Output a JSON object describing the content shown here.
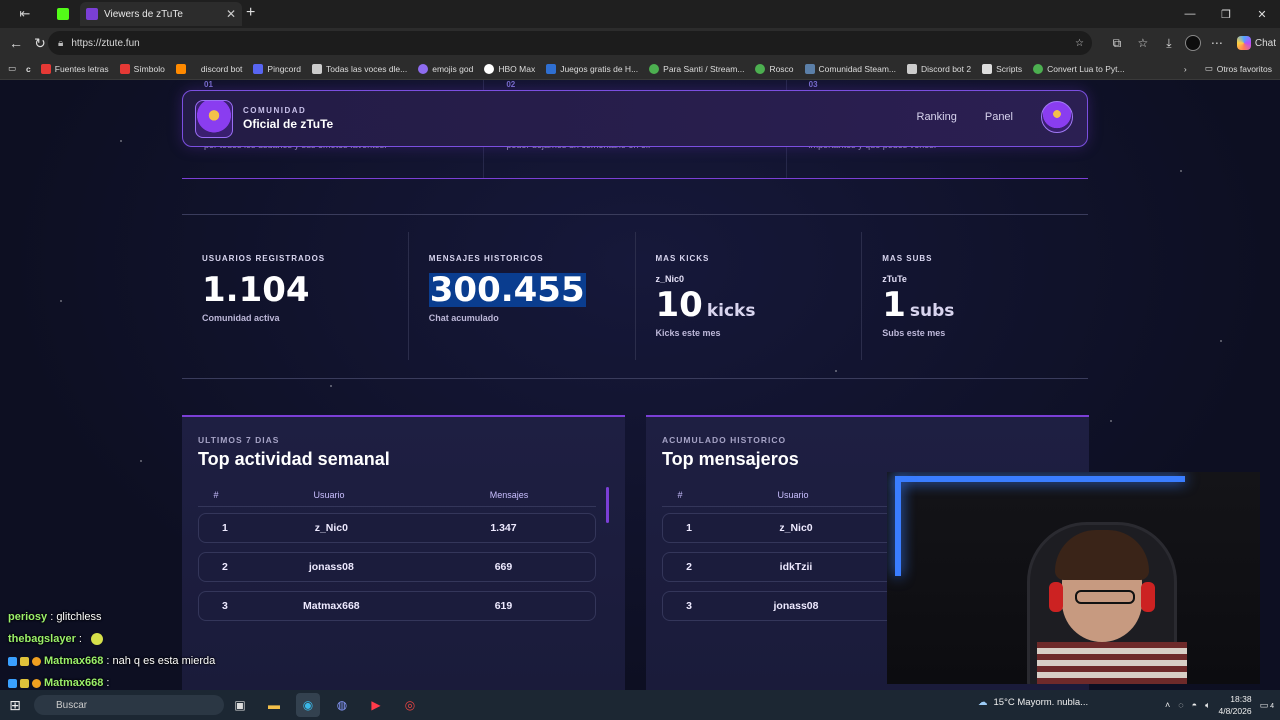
{
  "browser": {
    "tab_title": "Viewers de zTuTe",
    "url": "https://ztute.fun",
    "chat_label": "Chat",
    "bookmarks": [
      {
        "label": "Fuentes letras",
        "color": "#e53935"
      },
      {
        "label": "Símbolo",
        "color": "#e53935"
      },
      {
        "label": "",
        "color": "#ff8a00"
      },
      {
        "label": "discord bot",
        "color": "#2c2c2c"
      },
      {
        "label": "Pingcord",
        "color": "#5865f2"
      },
      {
        "label": "Todas las voces dle...",
        "color": "#cccccc"
      },
      {
        "label": "emojis god",
        "color": "#8e6cf0"
      },
      {
        "label": "HBO Max",
        "color": "#ffffff"
      },
      {
        "label": "Juegos gratis de H...",
        "color": "#2f6fd1"
      },
      {
        "label": "Para Santi / Stream...",
        "color": "#4caf50"
      },
      {
        "label": "Rosco",
        "color": "#4caf50"
      },
      {
        "label": "Comunidad Steam...",
        "color": "#1b2838"
      },
      {
        "label": "Discord bot 2",
        "color": "#cccccc"
      },
      {
        "label": "Scripts",
        "color": "#dddddd"
      },
      {
        "label": "Convert Lua to Pyt...",
        "color": "#4caf50"
      }
    ],
    "other_bookmarks": "Otros favoritos"
  },
  "topcards": [
    {
      "num": "01",
      "text": "por todos los usuarios y sus emotes favoritos."
    },
    {
      "num": "02",
      "text": "poder dejarnos un comentario en el."
    },
    {
      "num": "03",
      "text": "importantes y que podes verlos."
    }
  ],
  "hero": {
    "kicker": "COMUNIDAD",
    "title": "Oficial de zTuTe",
    "links": [
      "Ranking",
      "Panel"
    ]
  },
  "stats": [
    {
      "title": "USUARIOS REGISTRADOS",
      "value": "1.104",
      "caption": "Comunidad activa"
    },
    {
      "title": "MENSAJES HISTORICOS",
      "value": "300.455",
      "caption": "Chat acumulado"
    },
    {
      "title": "MAS KICKS",
      "sub": "z_Nic0",
      "value": "10",
      "unit": "kicks",
      "caption": "Kicks este mes"
    },
    {
      "title": "MAS SUBS",
      "sub": "zTuTe",
      "value": "1",
      "unit": "subs",
      "caption": "Subs este mes"
    }
  ],
  "weekly": {
    "kicker": "ULTIMOS 7 DIAS",
    "title": "Top actividad semanal",
    "headers": [
      "#",
      "Usuario",
      "Mensajes"
    ],
    "rows": [
      {
        "rank": "1",
        "user": "z_Nic0",
        "msgs": "1.347"
      },
      {
        "rank": "2",
        "user": "jonass08",
        "msgs": "669"
      },
      {
        "rank": "3",
        "user": "Matmax668",
        "msgs": "619"
      }
    ]
  },
  "alltime": {
    "kicker": "ACUMULADO HISTORICO",
    "title": "Top mensajeros",
    "headers": [
      "#",
      "Usuario"
    ],
    "rows": [
      {
        "rank": "1",
        "user": "z_Nic0"
      },
      {
        "rank": "2",
        "user": "idkTzii"
      },
      {
        "rank": "3",
        "user": "jonass08"
      }
    ]
  },
  "stream_chat": [
    {
      "user": "periosy",
      "msg": "glitchless"
    },
    {
      "user": "thebagslayer",
      "msg": ""
    },
    {
      "user": "Matmax668",
      "msg": "nah q es esta mierda"
    },
    {
      "user": "Matmax668",
      "msg": ""
    }
  ],
  "taskbar": {
    "search": "Buscar",
    "weather": "15°C  Mayorm. nubla...",
    "time": "18:38",
    "date": "4/8/2026",
    "notif_count": "4"
  }
}
